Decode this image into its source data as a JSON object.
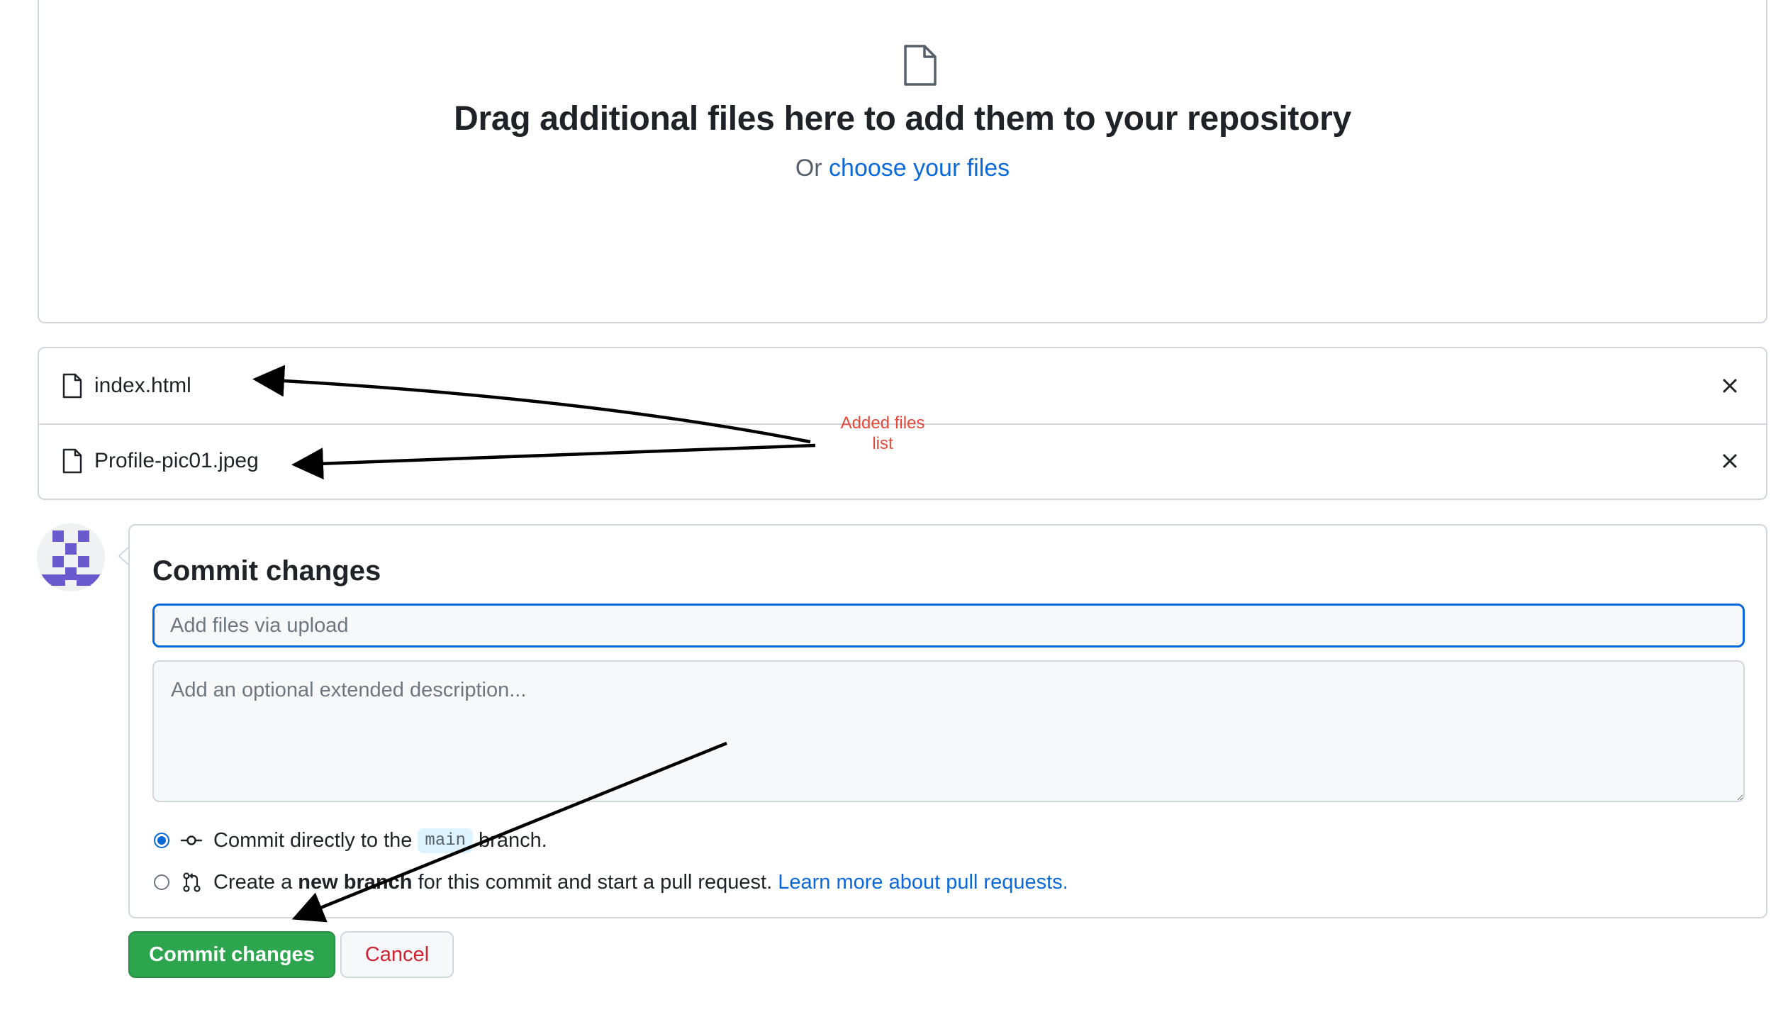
{
  "dropzone": {
    "title": "Drag additional files here to add them to your repository",
    "sub_prefix": "Or",
    "sub_link": "choose your files",
    "icon": "file-icon"
  },
  "files": [
    {
      "name": "index.html",
      "icon": "file-icon",
      "remove_icon": "close-icon"
    },
    {
      "name": "Profile-pic01.jpeg",
      "icon": "file-icon",
      "remove_icon": "close-icon"
    }
  ],
  "annotation": {
    "line1": "Added files",
    "line2": "list",
    "color": "#e5493a"
  },
  "commit": {
    "title": "Commit changes",
    "summary_placeholder": "Add files via upload",
    "description_placeholder": "Add an optional extended description...",
    "option_direct": {
      "prefix": "Commit directly to the",
      "branch": "main",
      "suffix": "branch.",
      "checked": true,
      "icon": "git-commit-icon"
    },
    "option_new_branch": {
      "prefix": "Create a",
      "bold": "new branch",
      "suffix": "for this commit and start a pull request.",
      "link": "Learn more about pull requests.",
      "checked": false,
      "icon": "git-pull-request-icon"
    }
  },
  "buttons": {
    "commit_label": "Commit changes",
    "cancel_label": "Cancel"
  },
  "colors": {
    "accent_blue": "#0969da",
    "commit_green": "#2da44e",
    "cancel_red": "#cf222e",
    "border": "#d0d7de",
    "avatar_purple": "#6a5acd"
  }
}
